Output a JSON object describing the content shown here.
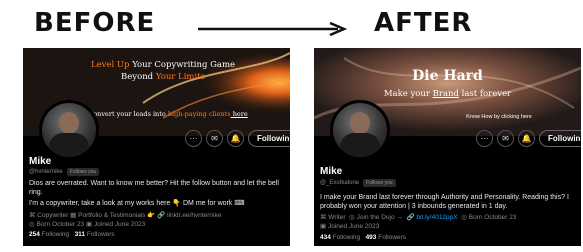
{
  "headings": {
    "before": "BEFORE",
    "after": "AFTER"
  },
  "before": {
    "banner": {
      "line1a": "Level Up ",
      "line1b": "Your Copywriting Game",
      "line2a": "Beyond ",
      "line2b": "Your Limits",
      "line3a": "Convert your leads into ",
      "line3b": "high-paying clients",
      "line3c": " here"
    },
    "following_label": "Following",
    "name": "Mike",
    "handle": "@hvnternike",
    "follows_you": "Follows you",
    "bio1": "Dios are overrated. Want to know me better? Hit the follow button and let the bell ring.",
    "bio2": "I'm a copywriter, take a look at my works here 👇 DM me for work ⌨",
    "meta_row1": "⌘ Copywriter   ▦ Portfolio & Testimonials 👉   🔗 linktr.ee/hvnternike",
    "meta_row2": "◎ Born October 23   ▣ Joined June 2023",
    "following_count": "254",
    "following_text": "Following",
    "followers_count": "311",
    "followers_text": "Followers"
  },
  "after": {
    "banner": {
      "title": "Die Hard",
      "sub_a": "Make your ",
      "sub_b": "Brand",
      "sub_c": " last forever",
      "know": "Know How by clicking here"
    },
    "following_label": "Following",
    "name": "Mike",
    "handle": "@_ExoIkalone",
    "follows_you": "Follows you",
    "bio": "I make your Brand last forever through Authority and Personality. Reading this? I probably won your attention | 3 inbounds generated in 1 day.",
    "meta_writer": "⌘ Writer",
    "meta_dojo": "◎ Join the Dojo →",
    "meta_link": "🔗 bit.ly/4012ppX",
    "meta_born": "◎ Born October 23",
    "meta_joined": "▣ Joined June 2023",
    "following_count": "434",
    "following_text": "Following",
    "followers_count": "493",
    "followers_text": "Followers"
  },
  "colors": {
    "accent_orange": "#ff7a1a",
    "link_blue": "#1d9bf0"
  }
}
